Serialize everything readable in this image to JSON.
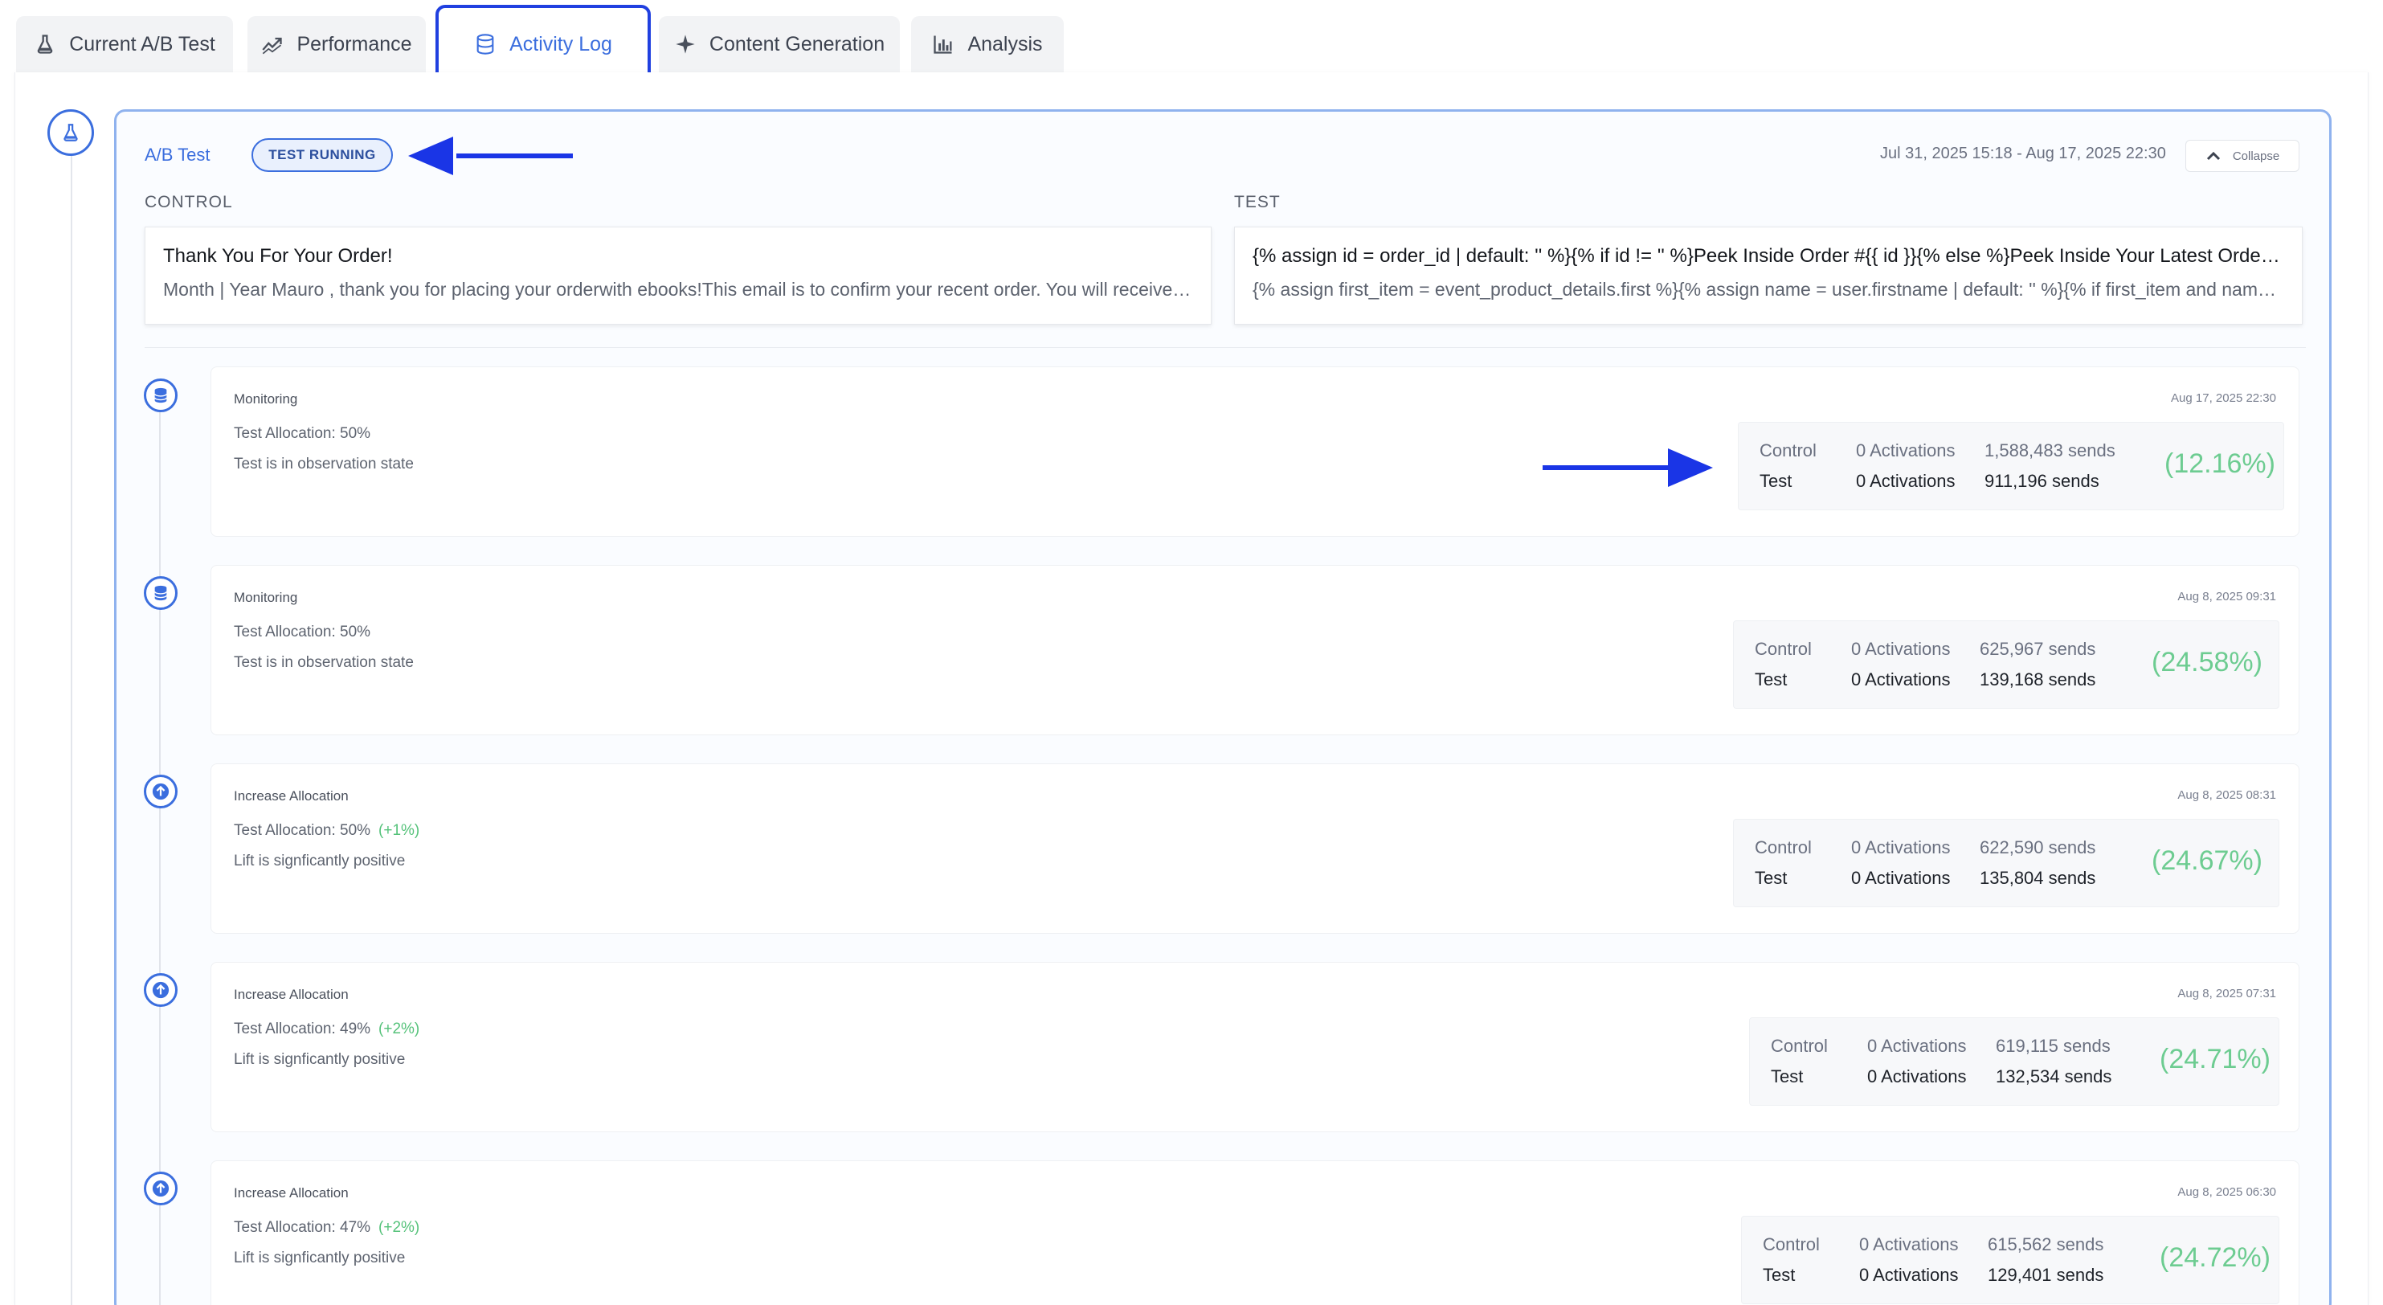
{
  "tabs": [
    {
      "label": "Current A/B Test",
      "icon": "flask-icon"
    },
    {
      "label": "Performance",
      "icon": "trend-line-icon"
    },
    {
      "label": "Activity Log",
      "icon": "database-icon",
      "active": true
    },
    {
      "label": "Content Generation",
      "icon": "sparkle-icon"
    },
    {
      "label": "Analysis",
      "icon": "bar-chart-icon"
    }
  ],
  "ab_test": {
    "title": "A/B Test",
    "status": "TEST RUNNING",
    "date_range": "Jul 31, 2025 15:18 - Aug 17, 2025 22:30",
    "collapse_label": "Collapse",
    "control_label": "CONTROL",
    "test_label": "TEST",
    "control": {
      "subject": "Thank You For Your Order!",
      "body": "Month | Year Mauro , thank you for placing your orderwith ebooks!This email is to confirm your recent order. You will receive an email when your order ships."
    },
    "test": {
      "subject": "{% assign id = order_id | default: '' %}{% if id != '' %}Peek Inside Order #{{ id }}{% else %}Peek Inside Your Latest Order{% endif %}",
      "body": "{% assign first_item = event_product_details.first %}{% assign name = user.firstname | default: '' %}{% if first_item and name %}"
    }
  },
  "stat_labels": {
    "control": "Control",
    "test": "Test"
  },
  "events": [
    {
      "title": "Monitoring",
      "allocation": "Test Allocation: 50%",
      "delta": "",
      "description": "Test is in observation state",
      "timestamp": "Aug 17, 2025 22:30",
      "icon": "database-icon",
      "control_activations": "0 Activations",
      "control_sends": "1,588,483 sends",
      "test_activations": "0 Activations",
      "test_sends": "911,196 sends",
      "lift": "(12.16%)"
    },
    {
      "title": "Monitoring",
      "allocation": "Test Allocation: 50%",
      "delta": "",
      "description": "Test is in observation state",
      "timestamp": "Aug 8, 2025 09:31",
      "icon": "database-icon",
      "control_activations": "0 Activations",
      "control_sends": "625,967 sends",
      "test_activations": "0 Activations",
      "test_sends": "139,168 sends",
      "lift": "(24.58%)"
    },
    {
      "title": "Increase Allocation",
      "allocation": "Test Allocation: 50%",
      "delta": "(+1%)",
      "description": "Lift is signficantly positive",
      "timestamp": "Aug 8, 2025 08:31",
      "icon": "arrow-up-icon",
      "control_activations": "0 Activations",
      "control_sends": "622,590 sends",
      "test_activations": "0 Activations",
      "test_sends": "135,804 sends",
      "lift": "(24.67%)"
    },
    {
      "title": "Increase Allocation",
      "allocation": "Test Allocation: 49%",
      "delta": "(+2%)",
      "description": "Lift is signficantly positive",
      "timestamp": "Aug 8, 2025 07:31",
      "icon": "arrow-up-icon",
      "control_activations": "0 Activations",
      "control_sends": "619,115 sends",
      "test_activations": "0 Activations",
      "test_sends": "132,534 sends",
      "lift": "(24.71%)"
    },
    {
      "title": "Increase Allocation",
      "allocation": "Test Allocation: 47%",
      "delta": "(+2%)",
      "description": "Lift is signficantly positive",
      "timestamp": "Aug 8, 2025 06:30",
      "icon": "arrow-up-icon",
      "control_activations": "0 Activations",
      "control_sends": "615,562 sends",
      "test_activations": "0 Activations",
      "test_sends": "129,401 sends",
      "lift": "(24.72%)"
    }
  ],
  "colors": {
    "accent": "#3b6ede",
    "annotation_arrow": "#1a35e6",
    "positive": "#6dcc91"
  }
}
